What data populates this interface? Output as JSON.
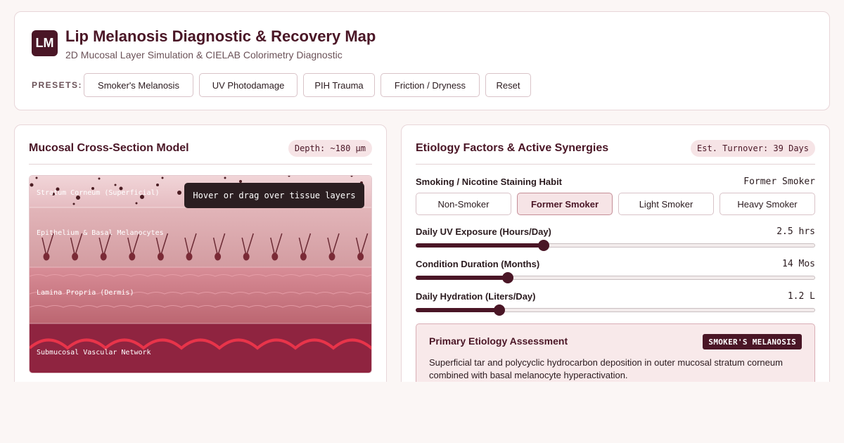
{
  "header": {
    "logo_text": "LM",
    "title": "Lip Melanosis Diagnostic & Recovery Map",
    "subtitle": "2D Mucosal Layer Simulation & CIELAB Colorimetry Diagnostic",
    "presets_label": "PRESETS:",
    "presets": [
      "Smoker's Melanosis",
      "UV Photodamage",
      "PIH Trauma",
      "Friction / Dryness",
      "Reset"
    ]
  },
  "model": {
    "title": "Mucosal Cross-Section Model",
    "depth_badge": "Depth: ~180 µm",
    "tooltip": "Hover or drag over tissue layers",
    "layers": [
      "Stratum Corneum (Superficial)",
      "Epithelium & Basal Melanocytes",
      "Lamina Propria (Dermis)",
      "Submucosal Vascular Network"
    ]
  },
  "factors": {
    "title": "Etiology Factors & Active Synergies",
    "turnover_badge": "Est. Turnover: 39 Days",
    "smoking": {
      "label": "Smoking / Nicotine Staining Habit",
      "value": "Former Smoker",
      "options": [
        "Non-Smoker",
        "Former Smoker",
        "Light Smoker",
        "Heavy Smoker"
      ],
      "selected": "Former Smoker"
    },
    "uv": {
      "label": "Daily UV Exposure (Hours/Day)",
      "value": "2.5 hrs",
      "level": 0.32
    },
    "duration": {
      "label": "Condition Duration (Months)",
      "value": "14 Mos",
      "level": 0.23
    },
    "hydration": {
      "label": "Daily Hydration (Liters/Day)",
      "value": "1.2 L",
      "level": 0.21
    }
  },
  "assessment": {
    "title": "Primary Etiology Assessment",
    "tag": "SMOKER'S MELANOSIS",
    "text": "Superficial tar and polycyclic hydrocarbon deposition in outer mucosal stratum corneum combined with basal melanocyte hyperactivation."
  },
  "colors": {
    "accent": "#4a1626",
    "stratum": "#eccbcf",
    "epithelium": "#d9a7ab",
    "lamina": "#c7737e",
    "vascular": "#8f2440",
    "vessel_line": "#e8344a"
  }
}
